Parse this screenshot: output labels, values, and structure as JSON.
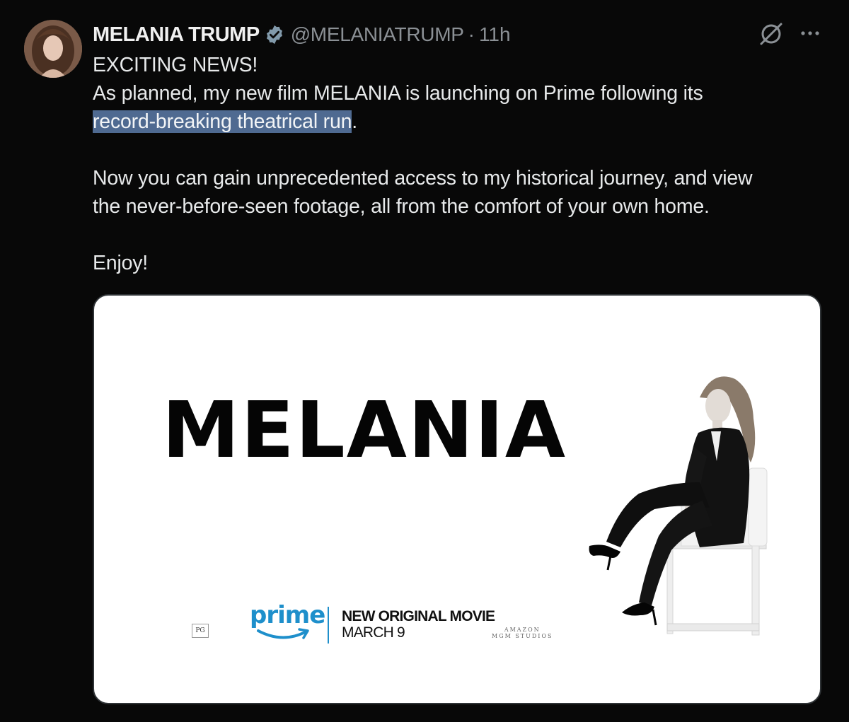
{
  "tweet": {
    "display_name": "MELANIA TRUMP",
    "handle": "@MELANIATRUMP",
    "separator": "·",
    "time": "11h",
    "lines": {
      "l1": "EXCITING NEWS!",
      "l2": "As planned, my new film MELANIA is launching on Prime following its",
      "l3_highlight": "record-breaking theatrical run",
      "l3_end": ".",
      "l4": "Now you can gain unprecedented access to my historical journey, and view",
      "l5": "the never-before-seen footage, all from the comfort of your own home.",
      "l6": "Enjoy!"
    }
  },
  "icons": {
    "verified": "verified-badge-icon",
    "grok": "grok-icon",
    "more": "more-options-icon"
  },
  "media": {
    "title": "MELANIA",
    "rating": "PG",
    "prime_word": "prime",
    "promo_line1": "NEW ORIGINAL MOVIE",
    "promo_line2": "MARCH 9",
    "studio_line1": "AMAZON",
    "studio_line2": "MGM STUDIOS"
  },
  "colors": {
    "background": "#080808",
    "highlight": "#4f6a91",
    "prime_blue": "#1e8fcb",
    "verified_fill": "#829aab"
  }
}
